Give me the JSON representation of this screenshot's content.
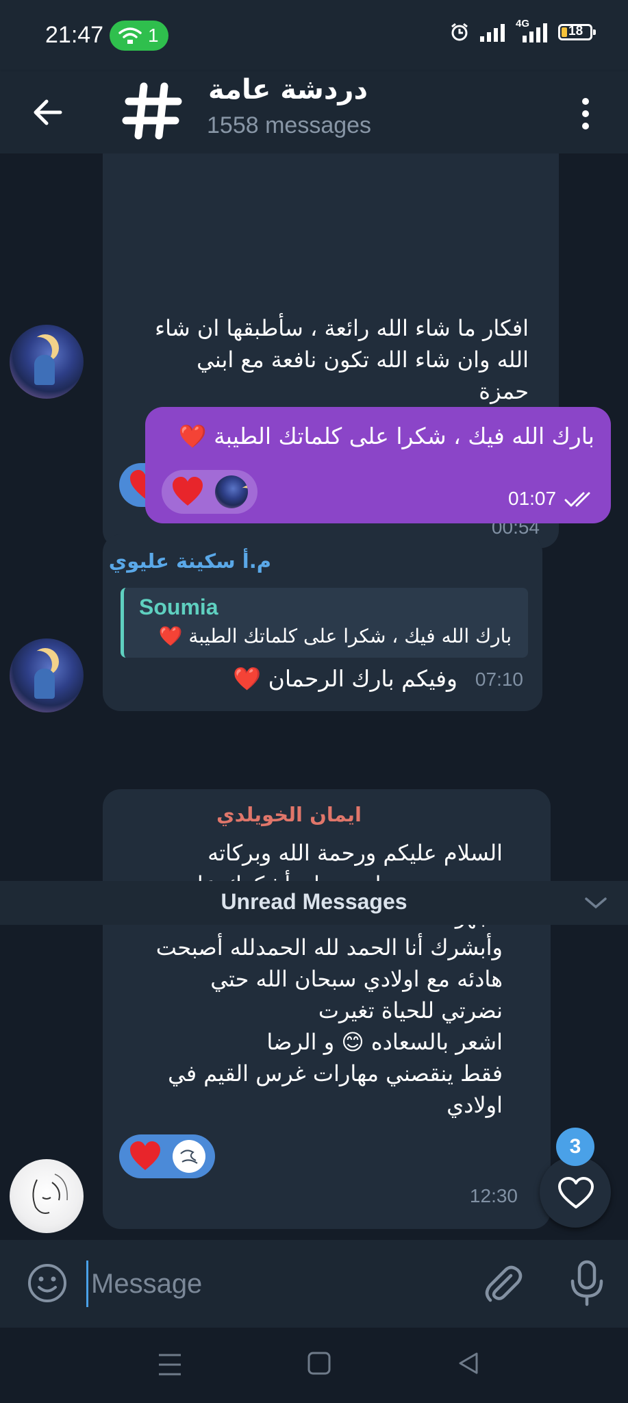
{
  "status_bar": {
    "time": "21:47",
    "hotspot_count": "1",
    "network": "4G",
    "battery_level": "18"
  },
  "header": {
    "title": "دردشة عامة",
    "subtitle": "1558 messages",
    "icon": "hash-icon"
  },
  "messages": [
    {
      "direction": "incoming",
      "text": "افكار ما شاء الله رائعة ، سأطبقها ان شاء\nالله وان شاء الله تكون نافعة مع ابني\nحمزة\nزادك الله علما ونفع بك الامة ❤️",
      "time": "00:54",
      "reaction": "❤️"
    },
    {
      "direction": "outgoing",
      "text": "بارك الله فيك ، شكرا على كلماتك الطيبة ❤️",
      "time": "01:07",
      "status": "read",
      "reaction": "❤️"
    },
    {
      "direction": "incoming",
      "sender": "م.أ سكينة عليوي",
      "reply_to": {
        "name": "Soumia",
        "text": "بارك الله فيك ، شكرا على كلماتك الطيبة ❤️"
      },
      "text": "وفيكم بارك الرحمان ❤️",
      "time": "07:10"
    },
    {
      "direction": "incoming",
      "sender": "ايمان الخويلدي",
      "text": "السلام عليكم ورحمة الله وبركاته\nحبيبتي سميه احببت ان أشكرك علي\nمجهودك\nوأبشرك أنا الحمد لله  الحمدلله أصبحت\nهادئه مع اولادي سبحان الله حتي\nنضرتي للحياة تغيرت\nاشعر بالسعاده 😊 و الرضا\nفقط ينقصني مهارات غرس القيم في\nاولادي",
      "time": "12:30",
      "reaction": "❤️"
    }
  ],
  "unread_divider": "Unread Messages",
  "reaction_fab": {
    "badge": "3",
    "icon": "heart-outline-icon"
  },
  "composer": {
    "placeholder": "Message"
  },
  "colors": {
    "background": "#141c27",
    "bar": "#1c2733",
    "incoming_bubble": "#212d3b",
    "outgoing_bubble": "#8b45c8",
    "accent": "#4aa1e8",
    "sender_1": "#5aa8e8",
    "sender_2": "#e0766a",
    "reply_name": "#5fd0c0"
  }
}
